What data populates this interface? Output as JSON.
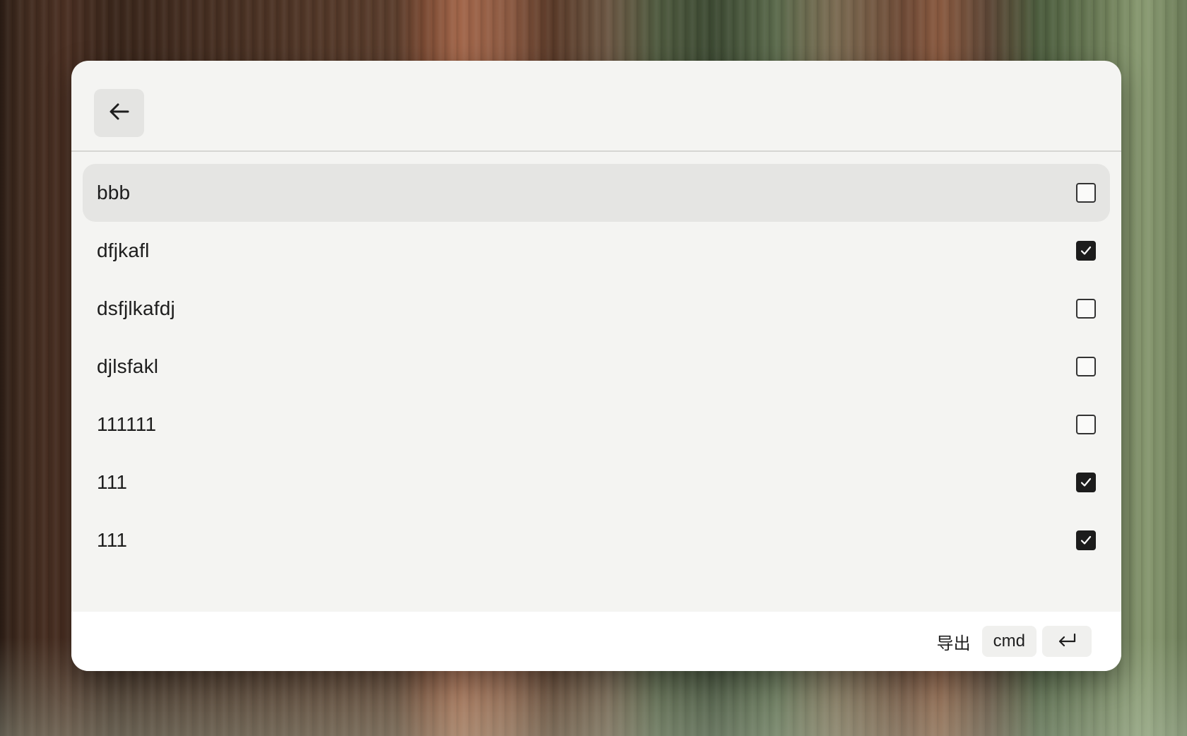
{
  "header": {
    "back_icon": "arrow-left-icon"
  },
  "items": [
    {
      "label": "bbb",
      "checked": false,
      "highlighted": true
    },
    {
      "label": "dfjkafl",
      "checked": true,
      "highlighted": false
    },
    {
      "label": "dsfjlkafdj",
      "checked": false,
      "highlighted": false
    },
    {
      "label": "djlsfakl",
      "checked": false,
      "highlighted": false
    },
    {
      "label": "111111",
      "checked": false,
      "highlighted": false
    },
    {
      "label": "111",
      "checked": true,
      "highlighted": false
    },
    {
      "label": "111",
      "checked": true,
      "highlighted": false
    }
  ],
  "footer": {
    "action_label": "导出",
    "key_cmd": "cmd",
    "key_enter_icon": "return-icon"
  }
}
